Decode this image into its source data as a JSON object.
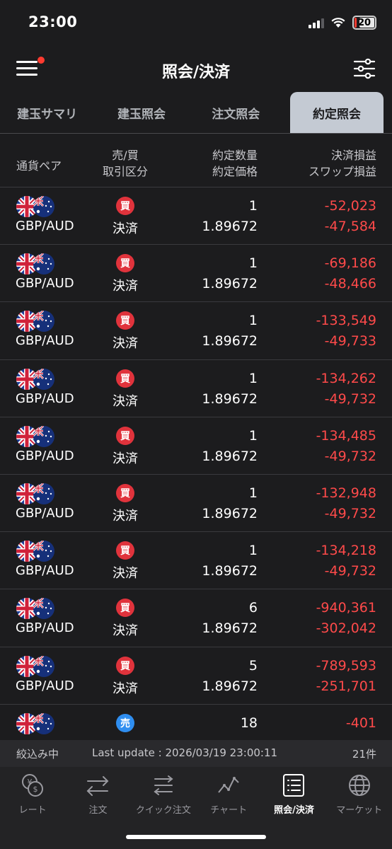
{
  "status": {
    "time": "23:00",
    "battery": "20"
  },
  "header": {
    "title": "照会/決済"
  },
  "tabs": [
    {
      "label": "建玉サマリ",
      "active": false
    },
    {
      "label": "建玉照会",
      "active": false
    },
    {
      "label": "注文照会",
      "active": false
    },
    {
      "label": "約定照会",
      "active": true
    }
  ],
  "columns": {
    "pair": "通貨ペア",
    "side_line1": "売/買",
    "side_line2": "取引区分",
    "qty_line1": "約定数量",
    "qty_line2": "約定価格",
    "pl_line1": "決済損益",
    "pl_line2": "スワップ損益"
  },
  "rows": [
    {
      "pair": "GBP/AUD",
      "side": "買",
      "type": "決済",
      "qty": "1",
      "price": "1.89672",
      "pl": "-52,023",
      "swap": "-47,584"
    },
    {
      "pair": "GBP/AUD",
      "side": "買",
      "type": "決済",
      "qty": "1",
      "price": "1.89672",
      "pl": "-69,186",
      "swap": "-48,466"
    },
    {
      "pair": "GBP/AUD",
      "side": "買",
      "type": "決済",
      "qty": "1",
      "price": "1.89672",
      "pl": "-133,549",
      "swap": "-49,733"
    },
    {
      "pair": "GBP/AUD",
      "side": "買",
      "type": "決済",
      "qty": "1",
      "price": "1.89672",
      "pl": "-134,262",
      "swap": "-49,732"
    },
    {
      "pair": "GBP/AUD",
      "side": "買",
      "type": "決済",
      "qty": "1",
      "price": "1.89672",
      "pl": "-134,485",
      "swap": "-49,732"
    },
    {
      "pair": "GBP/AUD",
      "side": "買",
      "type": "決済",
      "qty": "1",
      "price": "1.89672",
      "pl": "-132,948",
      "swap": "-49,732"
    },
    {
      "pair": "GBP/AUD",
      "side": "買",
      "type": "決済",
      "qty": "1",
      "price": "1.89672",
      "pl": "-134,218",
      "swap": "-49,732"
    },
    {
      "pair": "GBP/AUD",
      "side": "買",
      "type": "決済",
      "qty": "6",
      "price": "1.89672",
      "pl": "-940,361",
      "swap": "-302,042"
    },
    {
      "pair": "GBP/AUD",
      "side": "買",
      "type": "決済",
      "qty": "5",
      "price": "1.89672",
      "pl": "-789,593",
      "swap": "-251,701"
    },
    {
      "pair": "",
      "side": "売",
      "type": "",
      "qty": "18",
      "price": "",
      "pl": "-401",
      "swap": ""
    }
  ],
  "filter_bar": {
    "filter_label": "絞込み中",
    "last_update": "Last update : 2026/03/19 23:00:11",
    "count": "21件"
  },
  "bottom_nav": [
    {
      "label": "レート",
      "icon": "rate-icon",
      "active": false
    },
    {
      "label": "注文",
      "icon": "order-arrows-icon",
      "active": false
    },
    {
      "label": "クイック注文",
      "icon": "quick-order-icon",
      "active": false
    },
    {
      "label": "チャート",
      "icon": "chart-icon",
      "active": false
    },
    {
      "label": "照会/決済",
      "icon": "list-icon",
      "active": true
    },
    {
      "label": "マーケット",
      "icon": "globe-icon",
      "active": false
    }
  ],
  "colors": {
    "loss": "#ff4a4a",
    "buy": "#e0333c",
    "sell": "#2f8ef0",
    "active_tab": "#c4cad3"
  }
}
